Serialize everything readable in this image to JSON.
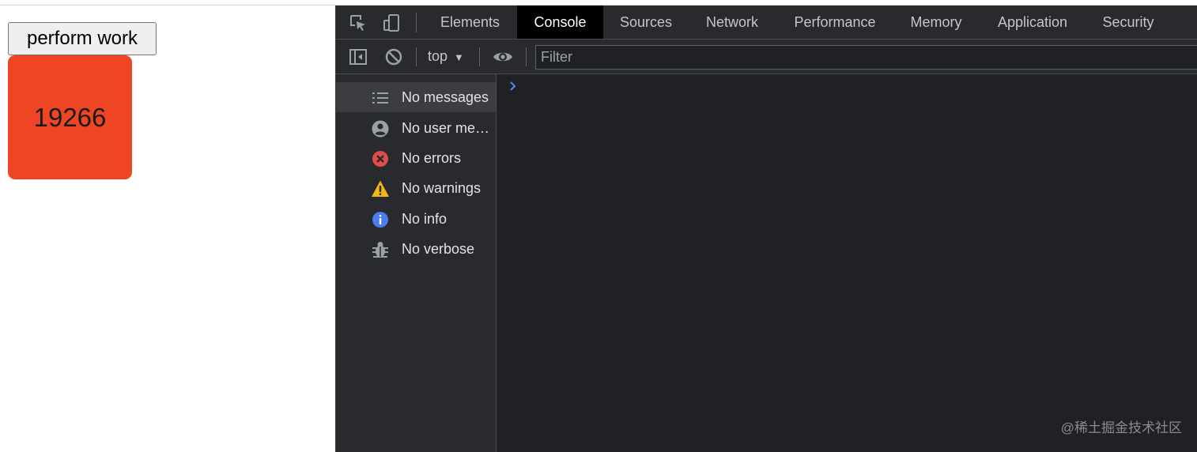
{
  "page": {
    "button_label": "perform work",
    "counter_value": "19266",
    "counter_color": "#ee4524"
  },
  "devtools": {
    "tabs": [
      "Elements",
      "Console",
      "Sources",
      "Network",
      "Performance",
      "Memory",
      "Application",
      "Security"
    ],
    "active_tab": "Console",
    "toolbar": {
      "context": "top",
      "filter_placeholder": "Filter"
    },
    "sidebar": [
      {
        "label": "No messages",
        "icon": "list-icon"
      },
      {
        "label": "No user me…",
        "icon": "user-icon"
      },
      {
        "label": "No errors",
        "icon": "error-icon"
      },
      {
        "label": "No warnings",
        "icon": "warning-icon"
      },
      {
        "label": "No info",
        "icon": "info-icon"
      },
      {
        "label": "No verbose",
        "icon": "bug-icon"
      }
    ],
    "selected_sidebar_item": "No messages"
  },
  "watermark": "@稀土掘金技术社区"
}
